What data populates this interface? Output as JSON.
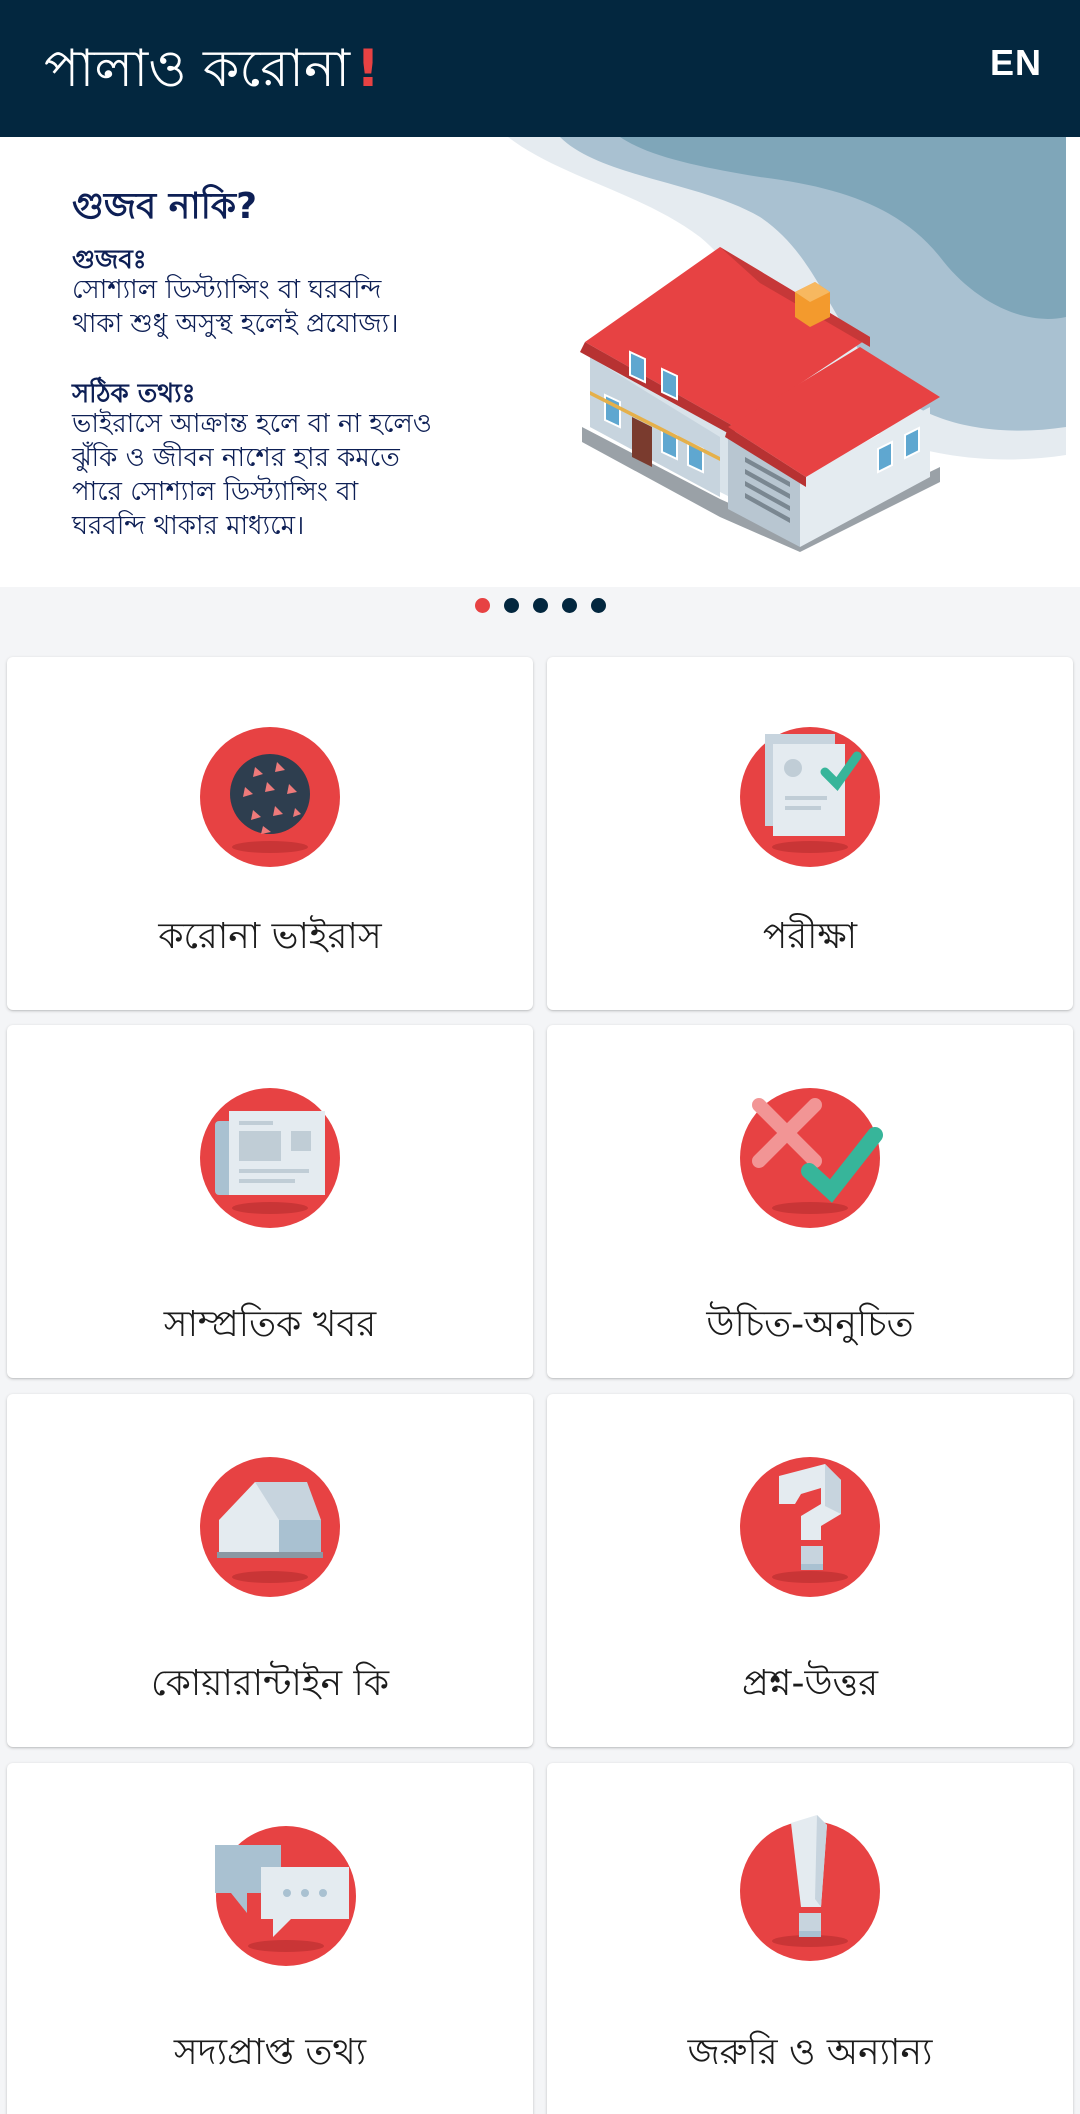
{
  "header": {
    "title": "পালাও করোনা",
    "exclaim": "!",
    "language_button": "EN"
  },
  "banner": {
    "title": "গুজব নাকি?",
    "rumor_label": "গুজবঃ",
    "rumor_text": "সোশ্যাল ডিস্ট্যান্সিং বা ঘরবন্দি\nথাকা শুধু অসুস্থ হলেই প্রযোজ্য।",
    "fact_label": "সঠিক তথ্যঃ",
    "fact_text": "ভাইরাসে আক্রান্ত হলে বা না হলেও\nঝুঁকি ও জীবন নাশের হার কমতে\nপারে সোশ্যাল ডিস্ট্যান্সিং বা\nঘরবন্দি থাকার মাধ্যমে।",
    "image": "house-illustration",
    "slide_count": 5,
    "active_slide": 1
  },
  "menu": {
    "items": [
      {
        "label": "করোনা ভাইরাস",
        "icon": "virus-icon"
      },
      {
        "label": "পরীক্ষা",
        "icon": "test-report-icon"
      },
      {
        "label": "সাম্প্রতিক খবর",
        "icon": "newspaper-icon"
      },
      {
        "label": "উচিত-অনুচিত",
        "icon": "do-dont-icon"
      },
      {
        "label": "কোয়ারান্টাইন কি",
        "icon": "house-icon"
      },
      {
        "label": "প্রশ্ন-উত্তর",
        "icon": "question-icon"
      },
      {
        "label": "সদ্যপ্রাপ্ত তথ্য",
        "icon": "chat-icon"
      },
      {
        "label": "জরুরি ও অন্যান্য",
        "icon": "exclamation-icon"
      }
    ]
  },
  "colors": {
    "appbar": "#03273f",
    "accent": "#e74243",
    "text_dark": "#0d1f55"
  }
}
